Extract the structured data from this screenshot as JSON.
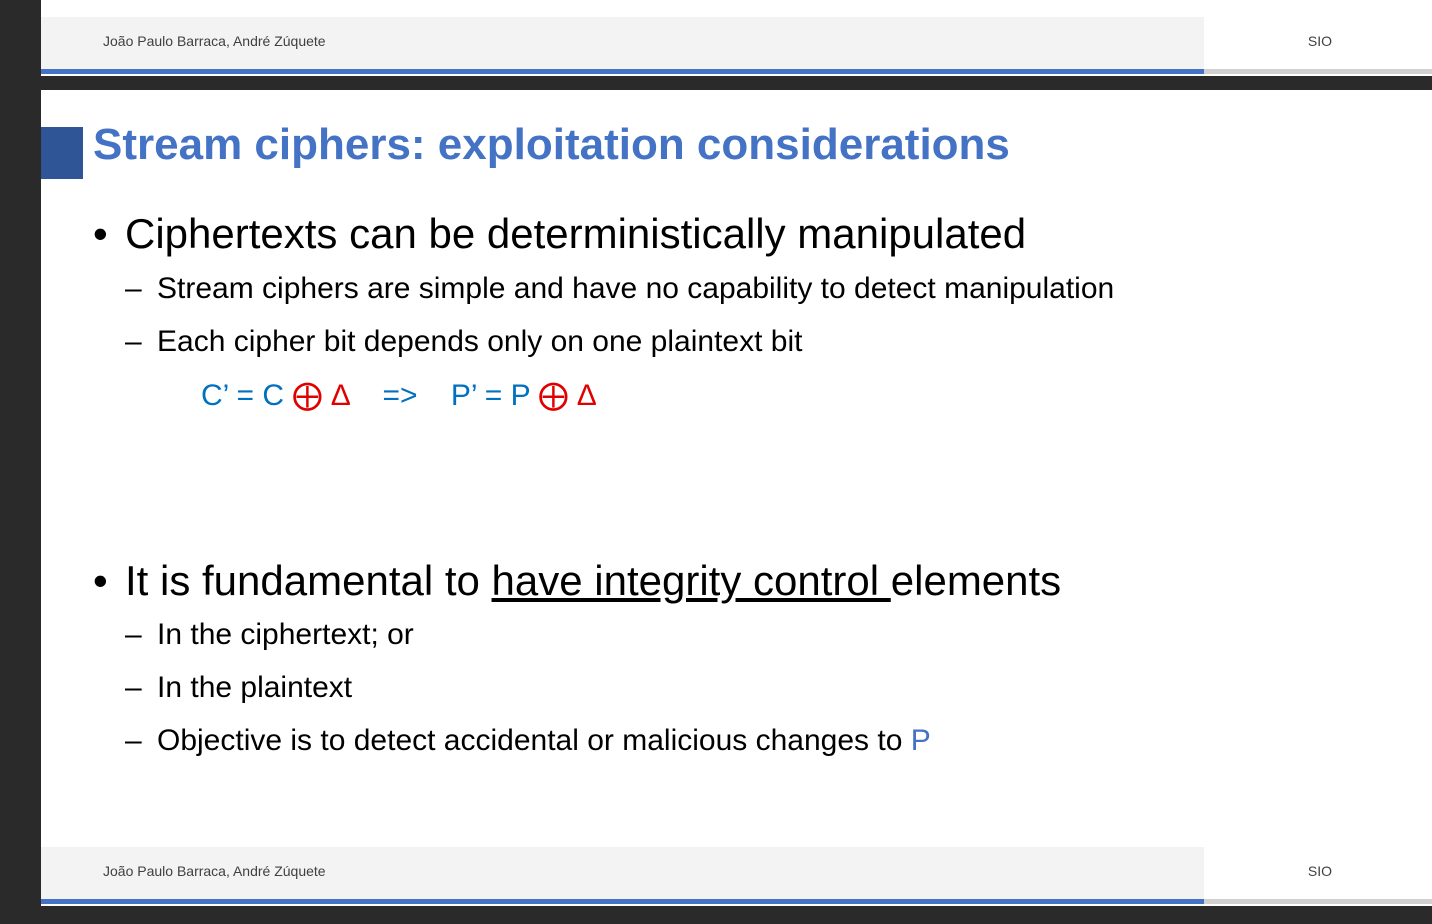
{
  "prev_slide": {
    "footer_author": "João Paulo Barraca, André Zúquete",
    "footer_course": "SIO"
  },
  "slide": {
    "title": "Stream ciphers: exploitation considerations",
    "bullet1": {
      "text": "Ciphertexts can be deterministically manipulated",
      "subs": [
        "Stream ciphers are simple and have no capability to detect manipulation",
        "Each cipher bit depends only on one plaintext bit"
      ]
    },
    "formula": {
      "c_prime": "C’ = C ",
      "xor1": "⨁ Δ",
      "arrow": "    =>    ",
      "p_prime": "P’ = P ",
      "xor2": "⨁ Δ"
    },
    "bullet2": {
      "prefix": "It is fundamental to ",
      "underlined": "have integrity control ",
      "suffix": "elements",
      "subs": [
        "In the ciphertext; or",
        "In the plaintext"
      ],
      "objective_text": "Objective is to detect accidental or malicious changes to ",
      "objective_highlight": "P"
    },
    "bullet_symbol": "•",
    "dash_symbol": "–",
    "footer_author": "João Paulo Barraca, André Zúquete",
    "footer_course": "SIO"
  },
  "colors": {
    "title": "#4472c4",
    "accent_blue": "#0070c0",
    "accent_red": "#e00000",
    "footer_line": "#4472c4"
  }
}
